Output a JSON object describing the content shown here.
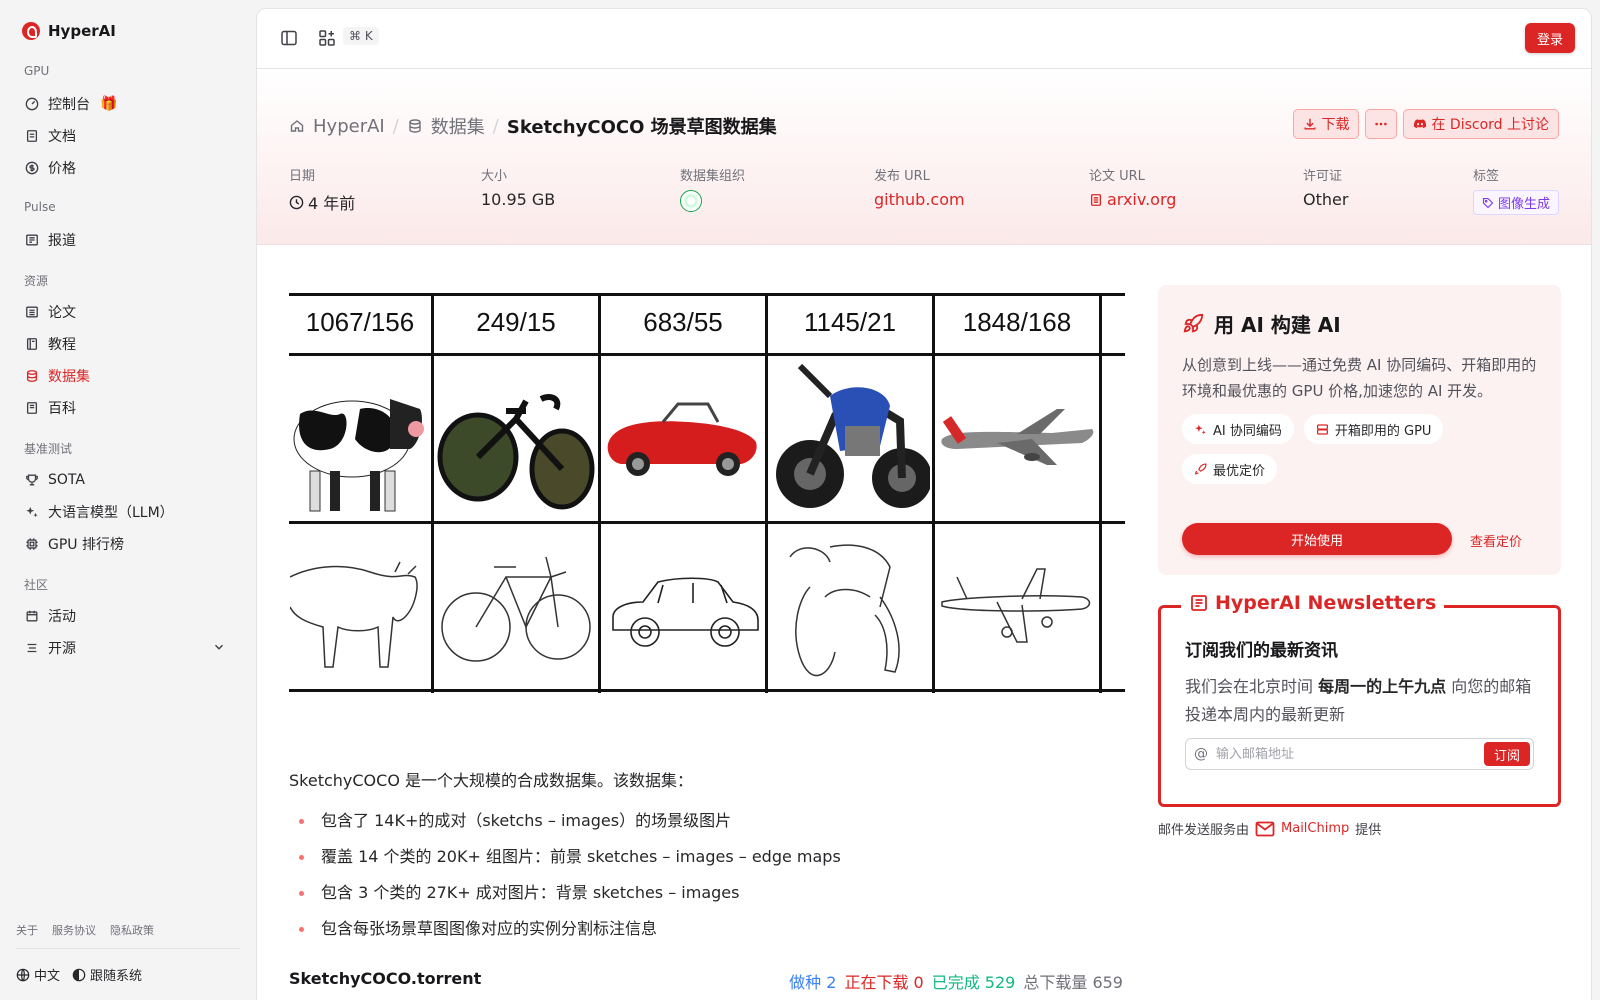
{
  "sidebar": {
    "brand": "HyperAI",
    "sections": {
      "gpu": "GPU",
      "pulse": "Pulse",
      "resources": "资源",
      "benchmarks": "基准测试",
      "community": "社区"
    },
    "items": {
      "console": "控制台",
      "docs": "文档",
      "pricing": "价格",
      "reports": "报道",
      "papers": "论文",
      "tutorials": "教程",
      "datasets": "数据集",
      "wiki": "百科",
      "sota": "SOTA",
      "llm": "大语言模型（LLM）",
      "gpu_rank": "GPU 排行榜",
      "events": "活动",
      "opensource": "开源"
    },
    "footer": {
      "about": "关于",
      "terms": "服务协议",
      "privacy": "隐私政策",
      "language": "中文",
      "theme": "跟随系统"
    }
  },
  "topbar": {
    "shortcut": "⌘ K",
    "login": "登录"
  },
  "header": {
    "crumb_home": "HyperAI",
    "crumb_datasets": "数据集",
    "title": "SketchyCOCO 场景草图数据集",
    "download": "下载",
    "discord": "在 Discord 上讨论",
    "meta": {
      "date_label": "日期",
      "date_value": "4 年前",
      "size_label": "大小",
      "size_value": "10.95 GB",
      "org_label": "数据集组织",
      "release_label": "发布 URL",
      "release_value": "github.com",
      "paper_label": "论文 URL",
      "paper_value": "arxiv.org",
      "license_label": "许可证",
      "license_value": "Other",
      "tags_label": "标签",
      "tag_value": "图像生成"
    }
  },
  "figure": {
    "headers": [
      "1067/156",
      "249/15",
      "683/55",
      "1145/21",
      "1848/168"
    ],
    "objects": [
      "cow",
      "bicycle",
      "car",
      "motorcycle",
      "airplane"
    ]
  },
  "content": {
    "intro": "SketchyCOCO 是一个大规模的合成数据集。该数据集：",
    "bullets": [
      "包含了 14K+的成对（sketchs – images）的场景级图片",
      "覆盖 14 个类的 20K+ 组图片：前景 sketches – images – edge maps",
      "包含 3 个类的 27K+ 成对图片：背景 sketches – images",
      "包含每张场景草图图像对应的实例分割标注信息"
    ],
    "torrent": "SketchyCOCO.torrent",
    "stats": {
      "seeding": "做种 2",
      "downloading": "正在下载 0",
      "completed": "已完成 529",
      "total": "总下载量 659"
    }
  },
  "promo": {
    "title": "用 AI 构建 AI",
    "text": "从创意到上线——通过免费 AI 协同编码、开箱即用的环境和最优惠的 GPU 价格,加速您的 AI 开发。",
    "chip1": "AI 协同编码",
    "chip2": "开箱即用的 GPU",
    "chip3": "最优定价",
    "start": "开始使用",
    "pricing": "查看定价"
  },
  "newsletter": {
    "legend": "HyperAI Newsletters",
    "heading": "订阅我们的最新资讯",
    "text_pre": "我们会在北京时间 ",
    "text_bold": "每周一的上午九点",
    "text_post": " 向您的邮箱投递本周内的最新更新",
    "placeholder": "输入邮箱地址",
    "subscribe": "订阅",
    "mail_pre": "邮件发送服务由",
    "mail_brand": "MailChimp",
    "mail_post": "提供"
  },
  "colors": {
    "accent": "#dc2626",
    "seed": "#3b82f6",
    "done": "#10b981"
  }
}
